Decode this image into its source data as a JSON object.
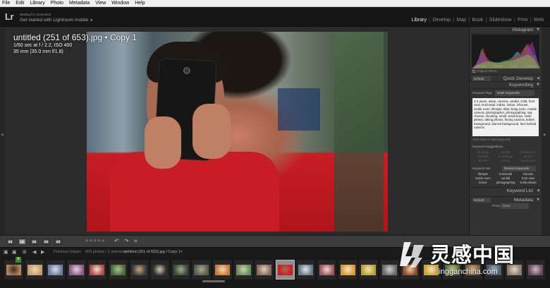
{
  "menu": [
    "File",
    "Edit",
    "Library",
    "Photo",
    "Metadata",
    "View",
    "Window",
    "Help"
  ],
  "header": {
    "logo": "Lr",
    "status_small": "Waiting for connection",
    "status_main": "Get started with Lightroom mobile",
    "modules": [
      {
        "label": "Library",
        "active": true
      },
      {
        "label": "Develop",
        "active": false
      },
      {
        "label": "Map",
        "active": false
      },
      {
        "label": "Book",
        "active": false
      },
      {
        "label": "Slideshow",
        "active": false
      },
      {
        "label": "Print",
        "active": false
      },
      {
        "label": "Web",
        "active": false
      }
    ]
  },
  "photo_info": {
    "title": "untitled (251 of 653).jpg • Copy 1",
    "exposure": "1/60 sec at f / 2.2, ISO 400",
    "lens": "35 mm (35.0 mm f/1.8)"
  },
  "right_panel": {
    "histogram_title": "Histogram",
    "histogram_info": [
      "ISO 400",
      "35 mm",
      "f / 2.2",
      "1/60 sec"
    ],
    "original_photo": "Original Photo",
    "quick_develop_preset": "Default",
    "quick_develop_title": "Quick Develop",
    "keywording_title": "Keywording",
    "keyword_tags_label": "Keyword Tags",
    "keyword_tags_select": "Enter Keywords",
    "keywords_text": "2-3 years, asian, camera, candid, child, front view, horizontal, indian, indoor, inhouse, inside room, lifestyle, little, living room, mobile camera, photographer, photographing, say cheese, shooting, small, small boys, smile please, taking photos, facing camera, bokeh background, blurred background, face behind camera",
    "click_to_add": "Click here to add keywords",
    "keyword_suggestions_label": "Keyword Suggestions",
    "suggestions": [
      "shooting",
      "portrait",
      "background",
      "handset",
      "technology",
      "person",
      "people",
      "entries",
      "studio shot"
    ],
    "keyword_set_label": "Keyword Set",
    "keyword_set_select": "Recent Keywords",
    "keyword_set": [
      "lifestyle",
      "horizontal",
      "inhouse",
      "inside room",
      "candid",
      "front view",
      "indoor",
      "photographing",
      "smile please"
    ],
    "keyword_list_title": "Keyword List",
    "metadata_preset": "Default",
    "metadata_title": "Metadata",
    "preset_label": "Preset",
    "preset_value": "None"
  },
  "filmstrip": {
    "badge": "8",
    "previous_import": "Previous Import",
    "count_text": "653 photos / 1 selected /",
    "current_file": "untitled (251 of 653).jpg / Copy 1",
    "selected_index": 13
  },
  "watermark": {
    "text_cn": "灵感中国",
    "url": "lingganchina.com"
  },
  "colors": {
    "accent_active": "#e6e6e6",
    "photo_shirt": "#c81d24",
    "keyword_box": "#f2f2f2"
  }
}
